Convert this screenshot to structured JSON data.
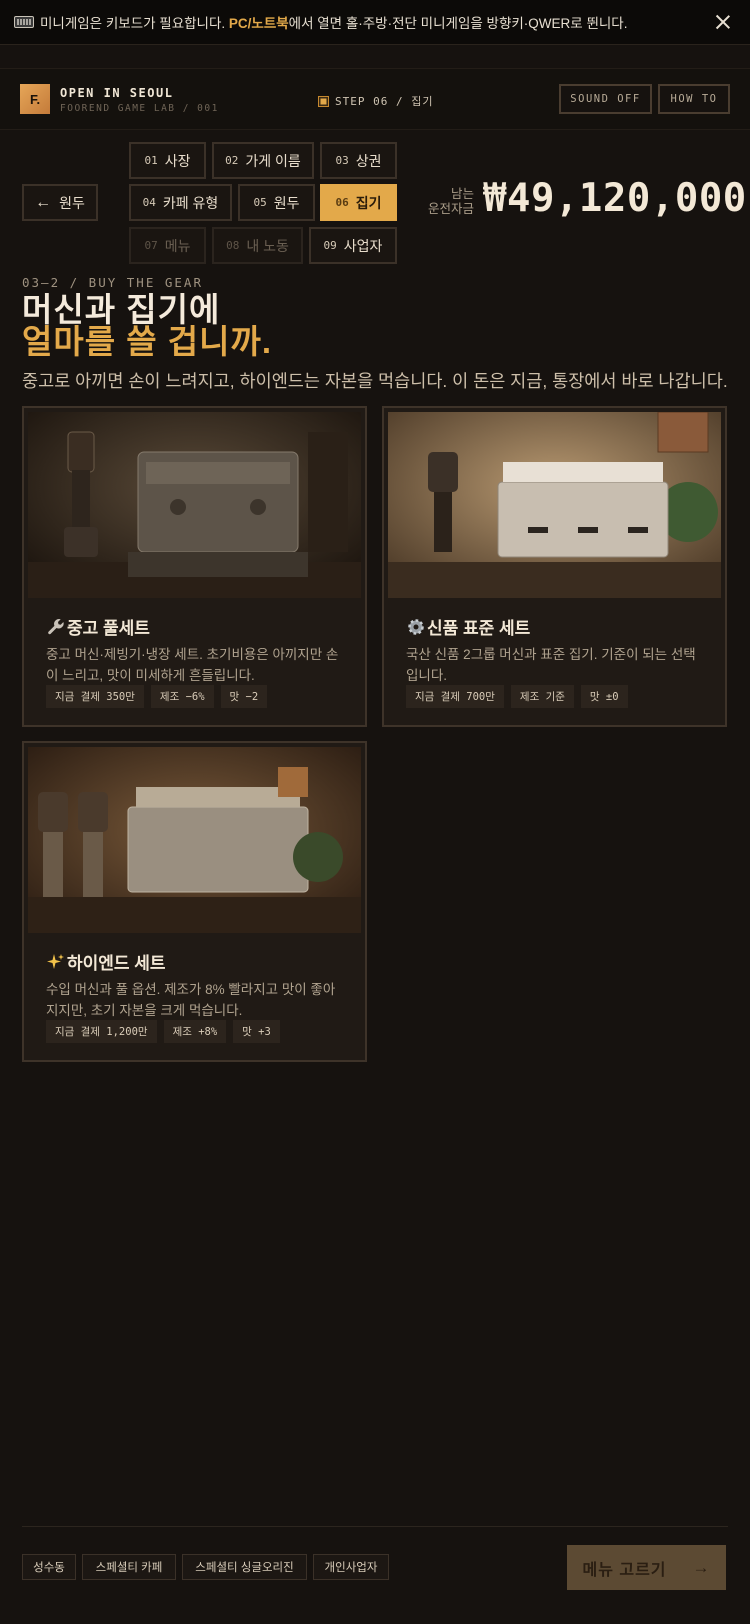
{
  "notice": {
    "text_before": "미니게임은 키보드가 필요합니다. ",
    "highlight": "PC/노트북",
    "text_after": "에서 열면 홀·주방·전단 미니게임을 방향키·QWER로 뛴니다."
  },
  "header": {
    "logo_letter": "F.",
    "title": "OPEN IN SEOUL",
    "subtitle": "FOOREND GAME LAB / 001",
    "step_indicator": "STEP 06 / 집기",
    "sound_label": "SOUND OFF",
    "howto_label": "HOW TO"
  },
  "nav": {
    "back_label": "원두",
    "steps": [
      {
        "num": "01",
        "label": "사장",
        "state": "done"
      },
      {
        "num": "02",
        "label": "가게 이름",
        "state": "done"
      },
      {
        "num": "03",
        "label": "상권",
        "state": "done"
      },
      {
        "num": "04",
        "label": "카페 유형",
        "state": "done"
      },
      {
        "num": "05",
        "label": "원두",
        "state": "done"
      },
      {
        "num": "06",
        "label": "집기",
        "state": "active"
      },
      {
        "num": "07",
        "label": "메뉴",
        "state": "disabled"
      },
      {
        "num": "08",
        "label": "내 노동",
        "state": "disabled"
      },
      {
        "num": "09",
        "label": "사업자",
        "state": "done"
      }
    ]
  },
  "funds": {
    "label_line1": "남는",
    "label_line2": "운전자금",
    "value": "₩49,120,000"
  },
  "heading": {
    "kicker": "03—2 / BUY THE GEAR",
    "line1": "머신과 집기에",
    "line2": "얼마를 쓸 겁니까.",
    "lead": "중고로 아끼면 손이 느려지고, 하이엔드는 자본을 먹습니다. 이 돈은 지금, 통장에서 바로 나갑니다."
  },
  "cards": [
    {
      "icon": "wrench-icon",
      "title": "중고 풀세트",
      "desc": "중고 머신·제빙기·냉장 세트. 초기비용은 아끼지만 손이 느리고, 맛이 미세하게 흔들립니다.",
      "tags": [
        "지금 결제 350만",
        "제조 −6%",
        "맛 −2"
      ]
    },
    {
      "icon": "gear-icon",
      "title": "신품 표준 세트",
      "desc": "국산 신품 2그룹 머신과 표준 집기. 기준이 되는 선택입니다.",
      "tags": [
        "지금 결제 700만",
        "제조 기준",
        "맛 ±0"
      ]
    },
    {
      "icon": "sparkles-icon",
      "title": "하이엔드 세트",
      "desc": "수입 머신과 풀 옵션. 제조가 8% 빨라지고 맛이 좋아지지만, 초기 자본을 크게 먹습니다.",
      "tags": [
        "지금 결제 1,200만",
        "제조 +8%",
        "맛 +3"
      ]
    }
  ],
  "footer": {
    "tags": [
      "성수동",
      "스페셜티 카페",
      "스페셜티 싱글오리진",
      "개인사업자"
    ],
    "cta_label": "메뉴 고르기"
  },
  "colors": {
    "accent": "#e3a94a",
    "background": "#16120f",
    "card": "#201a15"
  }
}
